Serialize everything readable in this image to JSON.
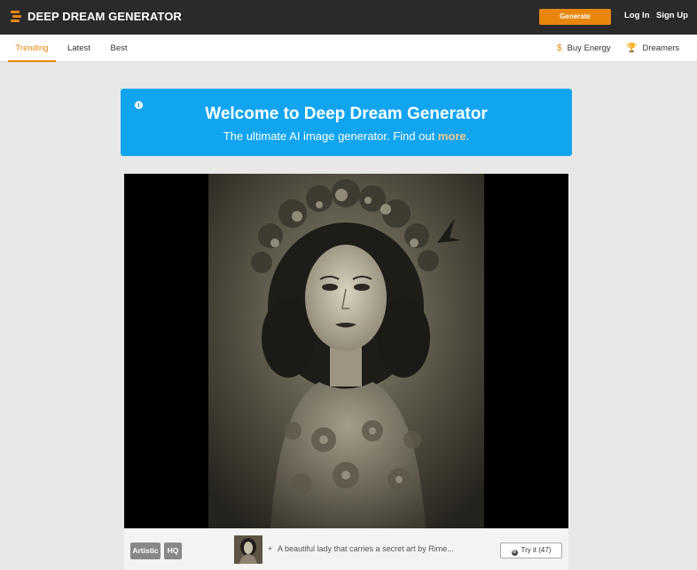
{
  "header": {
    "logo_text": "DEEP DREAM GENERATOR",
    "generate_label": "Generate",
    "login_label": "Log In",
    "signup_label": "Sign Up"
  },
  "tabs": [
    {
      "label": "Trending",
      "active": true
    },
    {
      "label": "Latest",
      "active": false
    },
    {
      "label": "Best",
      "active": false
    }
  ],
  "subnav_right": {
    "buy_energy": "Buy Energy",
    "dreamers": "Dreamers"
  },
  "banner": {
    "title": "Welcome to Deep Dream Generator",
    "text": "The ultimate AI image generator. Find out ",
    "link": "more",
    "suffix": "."
  },
  "card": {
    "tags": [
      "Artistic",
      "HQ"
    ],
    "description": "A beautiful lady that carries a secret art by Rime...",
    "try_label": "Try it (47)"
  },
  "colors": {
    "accent": "#e8860d",
    "banner_blue": "#11a5f0",
    "topbar": "#2a2a2c"
  }
}
